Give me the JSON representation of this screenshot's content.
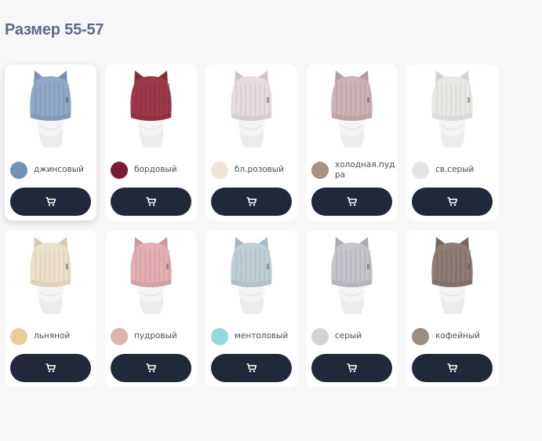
{
  "heading": "Размер 55-57",
  "products": [
    {
      "color_name": "джинсовый",
      "swatch": "#6f93b7",
      "hat": "#92a8c8",
      "hat_dark": "#7b91b3",
      "single_line": true,
      "active": true
    },
    {
      "color_name": "бордовый",
      "swatch": "#7b1b32",
      "hat": "#9d3a4a",
      "hat_dark": "#842d3c",
      "single_line": true
    },
    {
      "color_name": "бл.розовый",
      "swatch": "#efe4d8",
      "hat": "#e6dcdd",
      "hat_dark": "#cfc3c5",
      "single_line": true
    },
    {
      "color_name": "холодная.пудра",
      "swatch": "#a89283",
      "hat": "#cbb2b4",
      "hat_dark": "#b39b9e",
      "single_line": false
    },
    {
      "color_name": "св.серый",
      "swatch": "#e4e4e2",
      "hat": "#e9e8e4",
      "hat_dark": "#d3d2cd",
      "single_line": true
    },
    {
      "color_name": "льняной",
      "swatch": "#e7cd9c",
      "hat": "#ebe0c9",
      "hat_dark": "#d6c9ae",
      "single_line": true
    },
    {
      "color_name": "пудровый",
      "swatch": "#dcb6a8",
      "hat": "#e2b0b3",
      "hat_dark": "#cc989c",
      "single_line": true
    },
    {
      "color_name": "ментоловый",
      "swatch": "#95d8da",
      "hat": "#bfcfd6",
      "hat_dark": "#a6b8c0",
      "single_line": true
    },
    {
      "color_name": "серый",
      "swatch": "#d3d3d3",
      "hat": "#c4c4cb",
      "hat_dark": "#abacb3",
      "single_line": true
    },
    {
      "color_name": "кофейный",
      "swatch": "#9d8c80",
      "hat": "#8e7c75",
      "hat_dark": "#786760",
      "single_line": true
    }
  ],
  "icons": {
    "cart": "shopping-cart-icon"
  }
}
